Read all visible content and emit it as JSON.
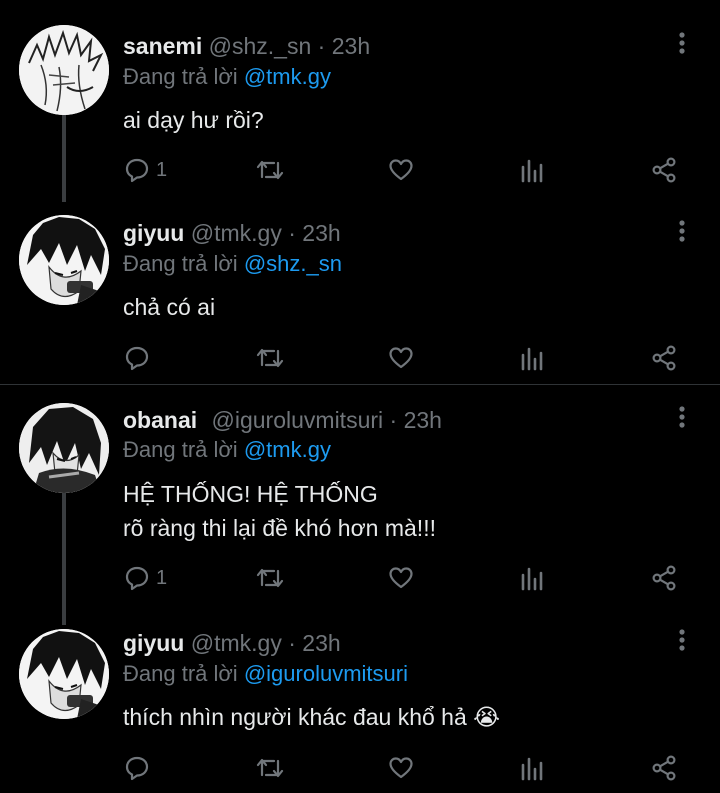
{
  "tweets": [
    {
      "name": "sanemi",
      "handle": "@shz._sn",
      "dot": "·",
      "time": "23h",
      "reply_prefix": "Đang trả lời",
      "reply_to": "@tmk.gy",
      "lines": [
        "ai dạy hư rồi?"
      ],
      "reply_count": "1",
      "avatar_icon": "sanemi-avatar"
    },
    {
      "name": "giyuu",
      "handle": "@tmk.gy",
      "dot": "·",
      "time": "23h",
      "reply_prefix": "Đang trả lời",
      "reply_to": "@shz._sn",
      "lines": [
        "chả có ai"
      ],
      "reply_count": "",
      "avatar_icon": "giyuu-avatar"
    },
    {
      "name": "obanai",
      "handle": "@iguroluvmitsuri",
      "dot": "·",
      "time": "23h",
      "reply_prefix": "Đang trả lời",
      "reply_to": "@tmk.gy",
      "lines": [
        "HỆ THỐNG! HỆ THỐNG",
        "rõ ràng thi lại đề khó hơn mà!!!"
      ],
      "reply_count": "1",
      "avatar_icon": "obanai-avatar"
    },
    {
      "name": "giyuu",
      "handle": "@tmk.gy",
      "dot": "·",
      "time": "23h",
      "reply_prefix": "Đang trả lời",
      "reply_to": "@iguroluvmitsuri",
      "lines": [
        "thích nhìn người khác đau khổ hả 😭"
      ],
      "reply_count": "",
      "avatar_icon": "giyuu-avatar"
    }
  ],
  "colors": {
    "background": "#000000",
    "text": "#e7e9ea",
    "muted": "#71767b",
    "mention": "#1d9bf0",
    "thread_line": "#3a3d40"
  },
  "action_icons": [
    "reply-icon",
    "retweet-icon",
    "like-icon",
    "views-icon",
    "share-icon"
  ]
}
